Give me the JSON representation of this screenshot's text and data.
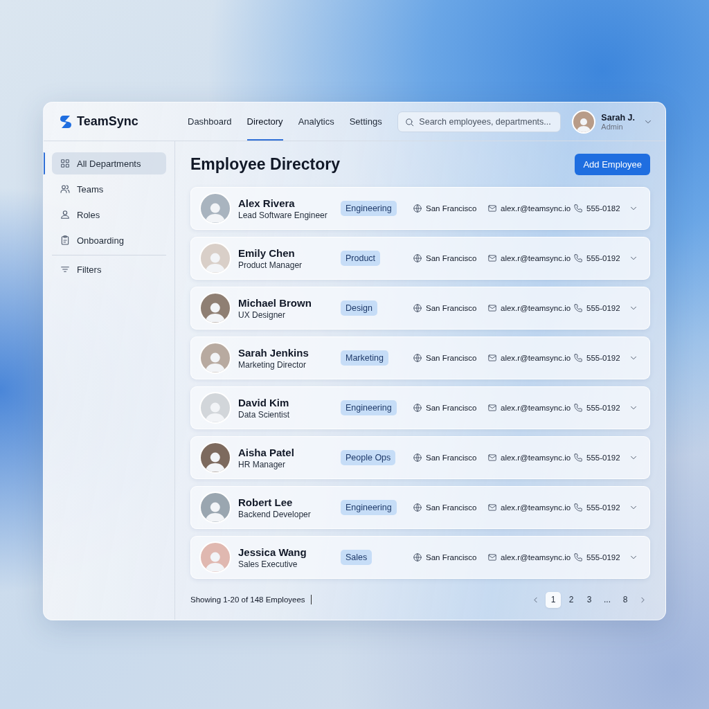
{
  "app": {
    "name": "TeamSync"
  },
  "nav": [
    {
      "label": "Dashboard",
      "selected": false
    },
    {
      "label": "Directory",
      "selected": true
    },
    {
      "label": "Analytics",
      "selected": false
    },
    {
      "label": "Settings",
      "selected": false
    }
  ],
  "search": {
    "placeholder": "Search employees, departments..."
  },
  "user": {
    "name": "Sarah J.",
    "role": "Admin"
  },
  "sidebar": {
    "items": [
      {
        "label": "All Departments",
        "selected": true
      },
      {
        "label": "Teams",
        "selected": false
      },
      {
        "label": "Roles",
        "selected": false
      },
      {
        "label": "Onboarding",
        "selected": false
      }
    ],
    "filters": {
      "label": "Filters"
    }
  },
  "page": {
    "title": "Employee Directory",
    "add_button": "Add Employee"
  },
  "employees": [
    {
      "name": "Alex Rivera",
      "title": "Lead Software Engineer",
      "department": "Engineering",
      "location": "San Francisco",
      "email": "alex.r@teamsync.io",
      "phone": "555-0182"
    },
    {
      "name": "Emily Chen",
      "title": "Product Manager",
      "department": "Product",
      "location": "San Francisco",
      "email": "alex.r@teamsync.io",
      "phone": "555-0192"
    },
    {
      "name": "Michael Brown",
      "title": "UX Designer",
      "department": "Design",
      "location": "San Francisco",
      "email": "alex.r@teamsync.io",
      "phone": "555-0192"
    },
    {
      "name": "Sarah Jenkins",
      "title": "Marketing Director",
      "department": "Marketing",
      "location": "San Francisco",
      "email": "alex.r@teamsync.io",
      "phone": "555-0192"
    },
    {
      "name": "David Kim",
      "title": "Data Scientist",
      "department": "Engineering",
      "location": "San Francisco",
      "email": "alex.r@teamsync.io",
      "phone": "555-0192"
    },
    {
      "name": "Aisha Patel",
      "title": "HR Manager",
      "department": "People Ops",
      "location": "San Francisco",
      "email": "alex.r@teamsync.io",
      "phone": "555-0192"
    },
    {
      "name": "Robert Lee",
      "title": "Backend Developer",
      "department": "Engineering",
      "location": "San Francisco",
      "email": "alex.r@teamsync.io",
      "phone": "555-0192"
    },
    {
      "name": "Jessica Wang",
      "title": "Sales Executive",
      "department": "Sales",
      "location": "San Francisco",
      "email": "alex.r@teamsync.io",
      "phone": "555-0192"
    }
  ],
  "footer": {
    "summary": "Showing 1-20 of 148 Employees",
    "pages": [
      {
        "label": "1",
        "selected": true
      },
      {
        "label": "2",
        "selected": false
      },
      {
        "label": "3",
        "selected": false
      },
      {
        "label": "...",
        "selected": false
      },
      {
        "label": "8",
        "selected": false
      }
    ]
  }
}
